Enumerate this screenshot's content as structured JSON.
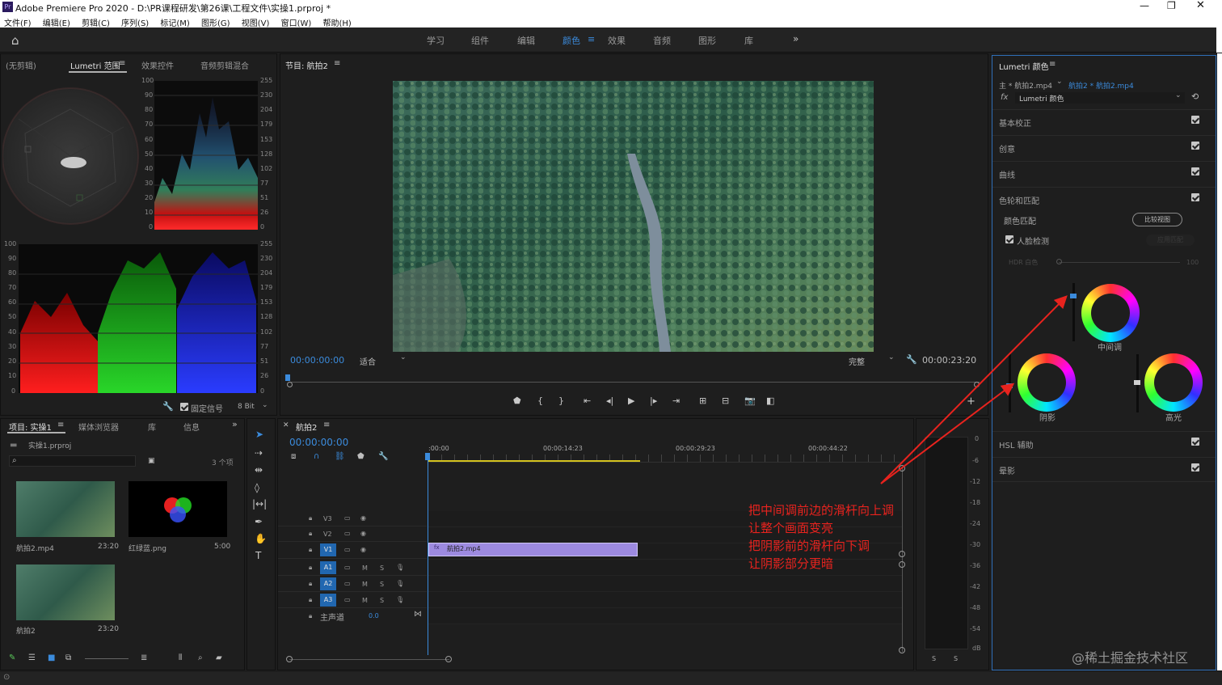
{
  "app": {
    "title": "Adobe Premiere Pro 2020 - D:\\PR课程研发\\第26课\\工程文件\\实操1.prproj *"
  },
  "menu": [
    "文件(F)",
    "编辑(E)",
    "剪辑(C)",
    "序列(S)",
    "标记(M)",
    "图形(G)",
    "视图(V)",
    "窗口(W)",
    "帮助(H)"
  ],
  "workspaces": [
    "学习",
    "组件",
    "编辑",
    "颜色",
    "效果",
    "音频",
    "图形",
    "库"
  ],
  "workspace_active": "颜色",
  "source_panel": {
    "tabs": [
      "(无剪辑)",
      "Lumetri 范围",
      "效果控件",
      "音频剪辑混合"
    ],
    "active_tab": "Lumetri 范围",
    "hist_left_ticks": [
      "100",
      "90",
      "80",
      "70",
      "60",
      "50",
      "40",
      "30",
      "20",
      "10",
      "0"
    ],
    "hist_right_ticks": [
      "255",
      "230",
      "204",
      "179",
      "153",
      "128",
      "102",
      "77",
      "51",
      "26",
      "0"
    ],
    "parade_left_ticks": [
      "100",
      "90",
      "80",
      "70",
      "60",
      "50",
      "40",
      "30",
      "20",
      "10",
      "0"
    ],
    "parade_right_ticks": [
      "255",
      "230",
      "204",
      "179",
      "153",
      "128",
      "102",
      "77",
      "51",
      "26",
      "0"
    ],
    "clamp_label": "固定信号",
    "bit_depth": "8 Bit"
  },
  "program": {
    "title": "节目: 航拍2",
    "timecode_left": "00:00:00:00",
    "fit": "适合",
    "quality": "完整",
    "timecode_right": "00:00:23:20"
  },
  "project": {
    "tabs": [
      "项目: 实操1",
      "媒体浏览器",
      "库",
      "信息"
    ],
    "active_tab": "项目: 实操1",
    "file": "实操1.prproj",
    "count": "3 个项",
    "items": [
      {
        "name": "航拍2.mp4",
        "duration": "23:20"
      },
      {
        "name": "红绿蓝.png",
        "duration": "5:00"
      },
      {
        "name": "航拍2",
        "duration": "23:20"
      }
    ]
  },
  "timeline": {
    "tab": "航拍2",
    "timecode": "00:00:00:00",
    "ruler": [
      ":00:00",
      "00:00:14:23",
      "00:00:29:23",
      "00:00:44:22"
    ],
    "tracks": [
      {
        "name": "V3",
        "type": "video"
      },
      {
        "name": "V2",
        "type": "video"
      },
      {
        "name": "V1",
        "type": "video",
        "target": true
      },
      {
        "name": "A1",
        "type": "audio",
        "m": "M",
        "s": "S"
      },
      {
        "name": "A2",
        "type": "audio",
        "m": "M",
        "s": "S"
      },
      {
        "name": "A3",
        "type": "audio",
        "m": "M",
        "s": "S"
      }
    ],
    "master": {
      "label": "主声道",
      "value": "0.0"
    },
    "clip": "航拍2.mp4",
    "meter_ticks": [
      "0",
      "-6",
      "-12",
      "-18",
      "-24",
      "-30",
      "-36",
      "-42",
      "-48",
      "-54",
      "dB"
    ],
    "meter_solo": [
      "S",
      "S"
    ]
  },
  "lumetri": {
    "title": "Lumetri 颜色",
    "source": "主 * 航拍2.mp4",
    "target": "航拍2 * 航拍2.mp4",
    "effect": "Lumetri 颜色",
    "sections": [
      "基本校正",
      "创意",
      "曲线",
      "色轮和匹配"
    ],
    "color_match": "颜色匹配",
    "compare_view": "比较视图",
    "face_detect": "人脸检测",
    "apply_match": "应用匹配",
    "hdr_label": "HDR 白色",
    "hdr_value": "100",
    "wheels": {
      "midtones": "中间调",
      "shadows": "阴影",
      "highlights": "高光"
    },
    "hsl": "HSL 辅助",
    "vignette": "晕影"
  },
  "annotation": {
    "lines": [
      "把中间调前边的滑杆向上调",
      "让整个画面变亮",
      "把阴影前的滑杆向下调",
      "让阴影部分更暗"
    ],
    "color": "#e8231e"
  },
  "watermark": "@稀土掘金技术社区",
  "colors": {
    "accent": "#3b8bdc",
    "clip": "#9d8ae0",
    "panel": "#1e1e1e",
    "annotation": "#e8231e"
  }
}
